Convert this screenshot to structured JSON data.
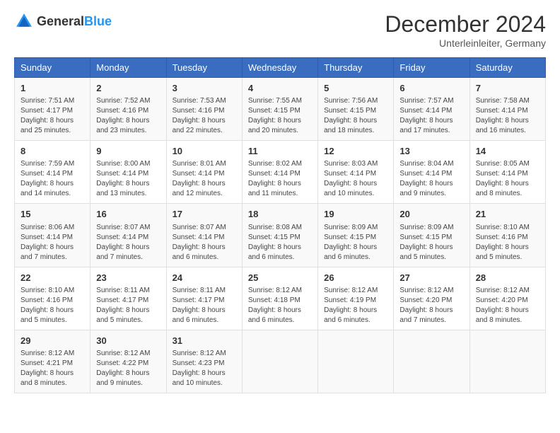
{
  "header": {
    "logo_general": "General",
    "logo_blue": "Blue",
    "month": "December 2024",
    "location": "Unterleinleiter, Germany"
  },
  "weekdays": [
    "Sunday",
    "Monday",
    "Tuesday",
    "Wednesday",
    "Thursday",
    "Friday",
    "Saturday"
  ],
  "weeks": [
    [
      {
        "day": "1",
        "sunrise": "7:51 AM",
        "sunset": "4:17 PM",
        "daylight": "8 hours and 25 minutes."
      },
      {
        "day": "2",
        "sunrise": "7:52 AM",
        "sunset": "4:16 PM",
        "daylight": "8 hours and 23 minutes."
      },
      {
        "day": "3",
        "sunrise": "7:53 AM",
        "sunset": "4:16 PM",
        "daylight": "8 hours and 22 minutes."
      },
      {
        "day": "4",
        "sunrise": "7:55 AM",
        "sunset": "4:15 PM",
        "daylight": "8 hours and 20 minutes."
      },
      {
        "day": "5",
        "sunrise": "7:56 AM",
        "sunset": "4:15 PM",
        "daylight": "8 hours and 18 minutes."
      },
      {
        "day": "6",
        "sunrise": "7:57 AM",
        "sunset": "4:14 PM",
        "daylight": "8 hours and 17 minutes."
      },
      {
        "day": "7",
        "sunrise": "7:58 AM",
        "sunset": "4:14 PM",
        "daylight": "8 hours and 16 minutes."
      }
    ],
    [
      {
        "day": "8",
        "sunrise": "7:59 AM",
        "sunset": "4:14 PM",
        "daylight": "8 hours and 14 minutes."
      },
      {
        "day": "9",
        "sunrise": "8:00 AM",
        "sunset": "4:14 PM",
        "daylight": "8 hours and 13 minutes."
      },
      {
        "day": "10",
        "sunrise": "8:01 AM",
        "sunset": "4:14 PM",
        "daylight": "8 hours and 12 minutes."
      },
      {
        "day": "11",
        "sunrise": "8:02 AM",
        "sunset": "4:14 PM",
        "daylight": "8 hours and 11 minutes."
      },
      {
        "day": "12",
        "sunrise": "8:03 AM",
        "sunset": "4:14 PM",
        "daylight": "8 hours and 10 minutes."
      },
      {
        "day": "13",
        "sunrise": "8:04 AM",
        "sunset": "4:14 PM",
        "daylight": "8 hours and 9 minutes."
      },
      {
        "day": "14",
        "sunrise": "8:05 AM",
        "sunset": "4:14 PM",
        "daylight": "8 hours and 8 minutes."
      }
    ],
    [
      {
        "day": "15",
        "sunrise": "8:06 AM",
        "sunset": "4:14 PM",
        "daylight": "8 hours and 7 minutes."
      },
      {
        "day": "16",
        "sunrise": "8:07 AM",
        "sunset": "4:14 PM",
        "daylight": "8 hours and 7 minutes."
      },
      {
        "day": "17",
        "sunrise": "8:07 AM",
        "sunset": "4:14 PM",
        "daylight": "8 hours and 6 minutes."
      },
      {
        "day": "18",
        "sunrise": "8:08 AM",
        "sunset": "4:15 PM",
        "daylight": "8 hours and 6 minutes."
      },
      {
        "day": "19",
        "sunrise": "8:09 AM",
        "sunset": "4:15 PM",
        "daylight": "8 hours and 6 minutes."
      },
      {
        "day": "20",
        "sunrise": "8:09 AM",
        "sunset": "4:15 PM",
        "daylight": "8 hours and 5 minutes."
      },
      {
        "day": "21",
        "sunrise": "8:10 AM",
        "sunset": "4:16 PM",
        "daylight": "8 hours and 5 minutes."
      }
    ],
    [
      {
        "day": "22",
        "sunrise": "8:10 AM",
        "sunset": "4:16 PM",
        "daylight": "8 hours and 5 minutes."
      },
      {
        "day": "23",
        "sunrise": "8:11 AM",
        "sunset": "4:17 PM",
        "daylight": "8 hours and 5 minutes."
      },
      {
        "day": "24",
        "sunrise": "8:11 AM",
        "sunset": "4:17 PM",
        "daylight": "8 hours and 6 minutes."
      },
      {
        "day": "25",
        "sunrise": "8:12 AM",
        "sunset": "4:18 PM",
        "daylight": "8 hours and 6 minutes."
      },
      {
        "day": "26",
        "sunrise": "8:12 AM",
        "sunset": "4:19 PM",
        "daylight": "8 hours and 6 minutes."
      },
      {
        "day": "27",
        "sunrise": "8:12 AM",
        "sunset": "4:20 PM",
        "daylight": "8 hours and 7 minutes."
      },
      {
        "day": "28",
        "sunrise": "8:12 AM",
        "sunset": "4:20 PM",
        "daylight": "8 hours and 8 minutes."
      }
    ],
    [
      {
        "day": "29",
        "sunrise": "8:12 AM",
        "sunset": "4:21 PM",
        "daylight": "8 hours and 8 minutes."
      },
      {
        "day": "30",
        "sunrise": "8:12 AM",
        "sunset": "4:22 PM",
        "daylight": "8 hours and 9 minutes."
      },
      {
        "day": "31",
        "sunrise": "8:12 AM",
        "sunset": "4:23 PM",
        "daylight": "8 hours and 10 minutes."
      },
      null,
      null,
      null,
      null
    ]
  ],
  "labels": {
    "sunrise_prefix": "Sunrise: ",
    "sunset_prefix": "Sunset: ",
    "daylight_prefix": "Daylight: "
  }
}
